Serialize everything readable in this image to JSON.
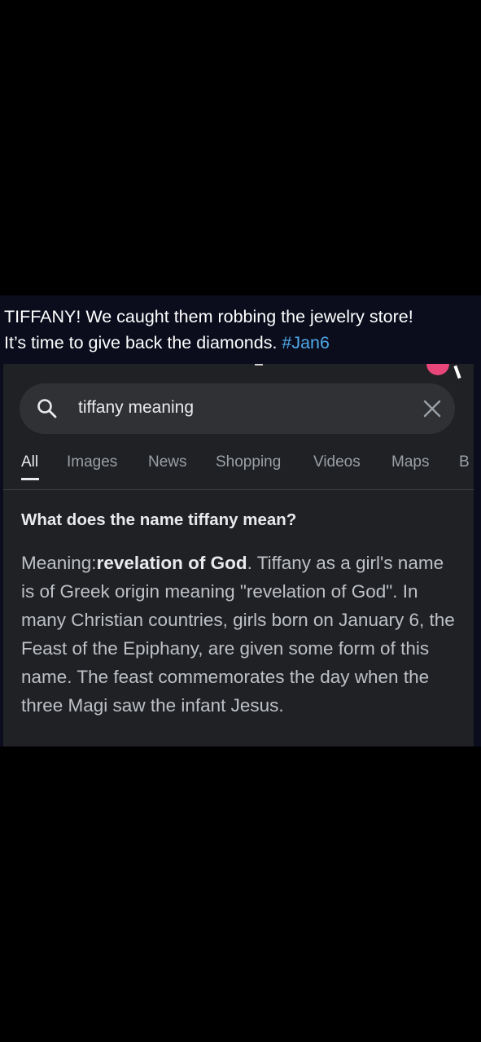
{
  "post": {
    "caption_line1": "TIFFANY! We caught them robbing the jewelry store!",
    "caption_line2_text": "It’s time to give back the diamonds. ",
    "caption_hashtag": "#Jan6"
  },
  "search": {
    "query": "tiffany meaning",
    "search_icon": "search-icon",
    "clear_icon": "close-icon"
  },
  "tabs": [
    {
      "label": "All",
      "active": true
    },
    {
      "label": "Images"
    },
    {
      "label": "News"
    },
    {
      "label": "Shopping"
    },
    {
      "label": "Videos"
    },
    {
      "label": "Maps"
    },
    {
      "label": "B"
    }
  ],
  "result": {
    "question": "What does the name tiffany mean?",
    "meaning_prefix": "Meaning:",
    "meaning_bold": "revelation of God",
    "body": ". Tiffany as a girl's name is of Greek origin meaning \"revelation of God\". In many Christian countries, girls born on January 6, the Feast of the Epiphany, are given some form of this name. The feast commemorates the day when the three Magi saw the infant Jesus."
  },
  "colors": {
    "background": "#000000",
    "post_background": "#0b0d1d",
    "hashtag": "#4fa8e8",
    "search_panel": "#202124",
    "search_bar": "#303134"
  }
}
